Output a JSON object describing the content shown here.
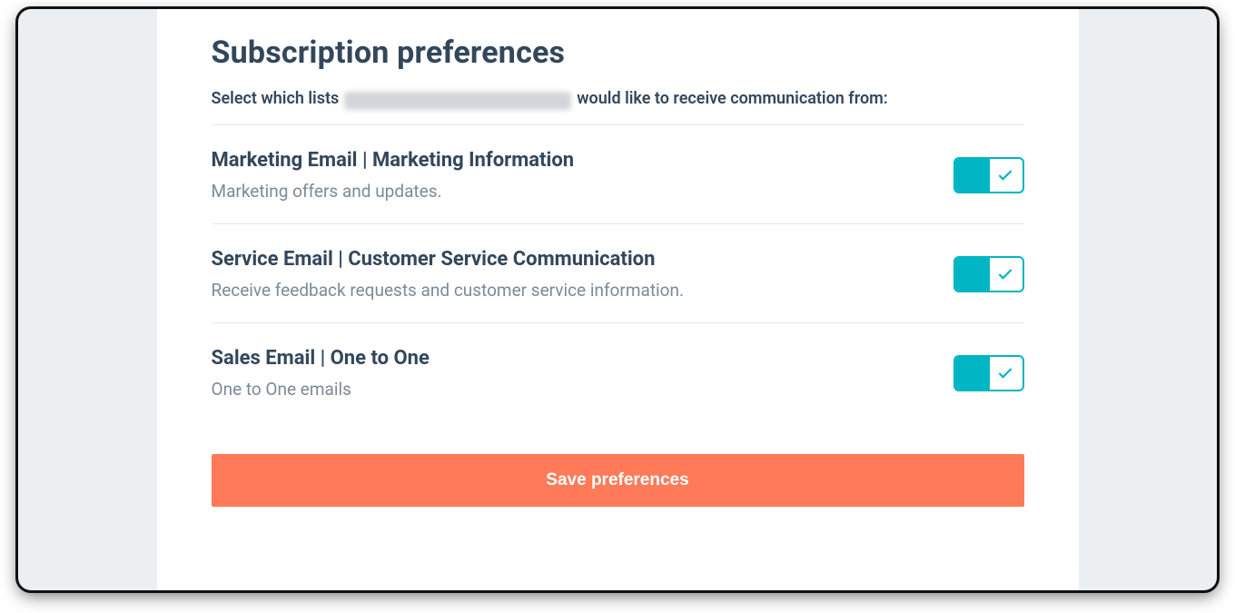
{
  "header": {
    "title": "Subscription preferences",
    "subtitle_prefix": "Select which lists",
    "subtitle_suffix": "would like to receive communication from:"
  },
  "preferences": [
    {
      "title": "Marketing Email | Marketing Information",
      "description": "Marketing offers and updates.",
      "enabled": true
    },
    {
      "title": "Service Email | Customer Service Communication",
      "description": "Receive feedback requests and customer service information.",
      "enabled": true
    },
    {
      "title": "Sales Email | One to One",
      "description": "One to One emails",
      "enabled": true
    }
  ],
  "actions": {
    "save_label": "Save preferences"
  },
  "colors": {
    "accent": "#00b5c4",
    "button": "#ff7a59",
    "text_primary": "#33475b",
    "text_secondary": "#7c8a99"
  }
}
